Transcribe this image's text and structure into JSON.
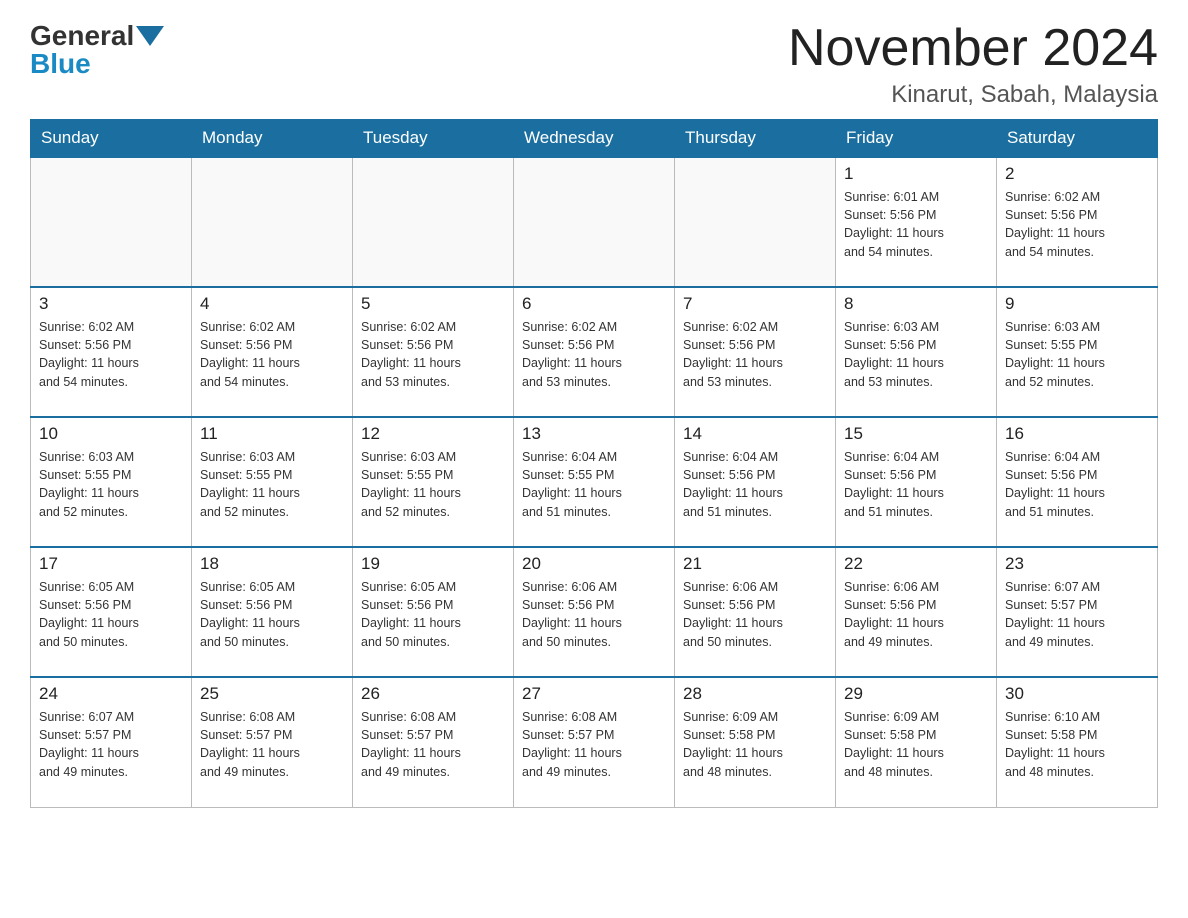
{
  "header": {
    "logo_general": "General",
    "logo_blue": "Blue",
    "month_title": "November 2024",
    "location": "Kinarut, Sabah, Malaysia"
  },
  "days_of_week": [
    "Sunday",
    "Monday",
    "Tuesday",
    "Wednesday",
    "Thursday",
    "Friday",
    "Saturday"
  ],
  "weeks": [
    [
      {
        "day": "",
        "info": ""
      },
      {
        "day": "",
        "info": ""
      },
      {
        "day": "",
        "info": ""
      },
      {
        "day": "",
        "info": ""
      },
      {
        "day": "",
        "info": ""
      },
      {
        "day": "1",
        "info": "Sunrise: 6:01 AM\nSunset: 5:56 PM\nDaylight: 11 hours\nand 54 minutes."
      },
      {
        "day": "2",
        "info": "Sunrise: 6:02 AM\nSunset: 5:56 PM\nDaylight: 11 hours\nand 54 minutes."
      }
    ],
    [
      {
        "day": "3",
        "info": "Sunrise: 6:02 AM\nSunset: 5:56 PM\nDaylight: 11 hours\nand 54 minutes."
      },
      {
        "day": "4",
        "info": "Sunrise: 6:02 AM\nSunset: 5:56 PM\nDaylight: 11 hours\nand 54 minutes."
      },
      {
        "day": "5",
        "info": "Sunrise: 6:02 AM\nSunset: 5:56 PM\nDaylight: 11 hours\nand 53 minutes."
      },
      {
        "day": "6",
        "info": "Sunrise: 6:02 AM\nSunset: 5:56 PM\nDaylight: 11 hours\nand 53 minutes."
      },
      {
        "day": "7",
        "info": "Sunrise: 6:02 AM\nSunset: 5:56 PM\nDaylight: 11 hours\nand 53 minutes."
      },
      {
        "day": "8",
        "info": "Sunrise: 6:03 AM\nSunset: 5:56 PM\nDaylight: 11 hours\nand 53 minutes."
      },
      {
        "day": "9",
        "info": "Sunrise: 6:03 AM\nSunset: 5:55 PM\nDaylight: 11 hours\nand 52 minutes."
      }
    ],
    [
      {
        "day": "10",
        "info": "Sunrise: 6:03 AM\nSunset: 5:55 PM\nDaylight: 11 hours\nand 52 minutes."
      },
      {
        "day": "11",
        "info": "Sunrise: 6:03 AM\nSunset: 5:55 PM\nDaylight: 11 hours\nand 52 minutes."
      },
      {
        "day": "12",
        "info": "Sunrise: 6:03 AM\nSunset: 5:55 PM\nDaylight: 11 hours\nand 52 minutes."
      },
      {
        "day": "13",
        "info": "Sunrise: 6:04 AM\nSunset: 5:55 PM\nDaylight: 11 hours\nand 51 minutes."
      },
      {
        "day": "14",
        "info": "Sunrise: 6:04 AM\nSunset: 5:56 PM\nDaylight: 11 hours\nand 51 minutes."
      },
      {
        "day": "15",
        "info": "Sunrise: 6:04 AM\nSunset: 5:56 PM\nDaylight: 11 hours\nand 51 minutes."
      },
      {
        "day": "16",
        "info": "Sunrise: 6:04 AM\nSunset: 5:56 PM\nDaylight: 11 hours\nand 51 minutes."
      }
    ],
    [
      {
        "day": "17",
        "info": "Sunrise: 6:05 AM\nSunset: 5:56 PM\nDaylight: 11 hours\nand 50 minutes."
      },
      {
        "day": "18",
        "info": "Sunrise: 6:05 AM\nSunset: 5:56 PM\nDaylight: 11 hours\nand 50 minutes."
      },
      {
        "day": "19",
        "info": "Sunrise: 6:05 AM\nSunset: 5:56 PM\nDaylight: 11 hours\nand 50 minutes."
      },
      {
        "day": "20",
        "info": "Sunrise: 6:06 AM\nSunset: 5:56 PM\nDaylight: 11 hours\nand 50 minutes."
      },
      {
        "day": "21",
        "info": "Sunrise: 6:06 AM\nSunset: 5:56 PM\nDaylight: 11 hours\nand 50 minutes."
      },
      {
        "day": "22",
        "info": "Sunrise: 6:06 AM\nSunset: 5:56 PM\nDaylight: 11 hours\nand 49 minutes."
      },
      {
        "day": "23",
        "info": "Sunrise: 6:07 AM\nSunset: 5:57 PM\nDaylight: 11 hours\nand 49 minutes."
      }
    ],
    [
      {
        "day": "24",
        "info": "Sunrise: 6:07 AM\nSunset: 5:57 PM\nDaylight: 11 hours\nand 49 minutes."
      },
      {
        "day": "25",
        "info": "Sunrise: 6:08 AM\nSunset: 5:57 PM\nDaylight: 11 hours\nand 49 minutes."
      },
      {
        "day": "26",
        "info": "Sunrise: 6:08 AM\nSunset: 5:57 PM\nDaylight: 11 hours\nand 49 minutes."
      },
      {
        "day": "27",
        "info": "Sunrise: 6:08 AM\nSunset: 5:57 PM\nDaylight: 11 hours\nand 49 minutes."
      },
      {
        "day": "28",
        "info": "Sunrise: 6:09 AM\nSunset: 5:58 PM\nDaylight: 11 hours\nand 48 minutes."
      },
      {
        "day": "29",
        "info": "Sunrise: 6:09 AM\nSunset: 5:58 PM\nDaylight: 11 hours\nand 48 minutes."
      },
      {
        "day": "30",
        "info": "Sunrise: 6:10 AM\nSunset: 5:58 PM\nDaylight: 11 hours\nand 48 minutes."
      }
    ]
  ]
}
